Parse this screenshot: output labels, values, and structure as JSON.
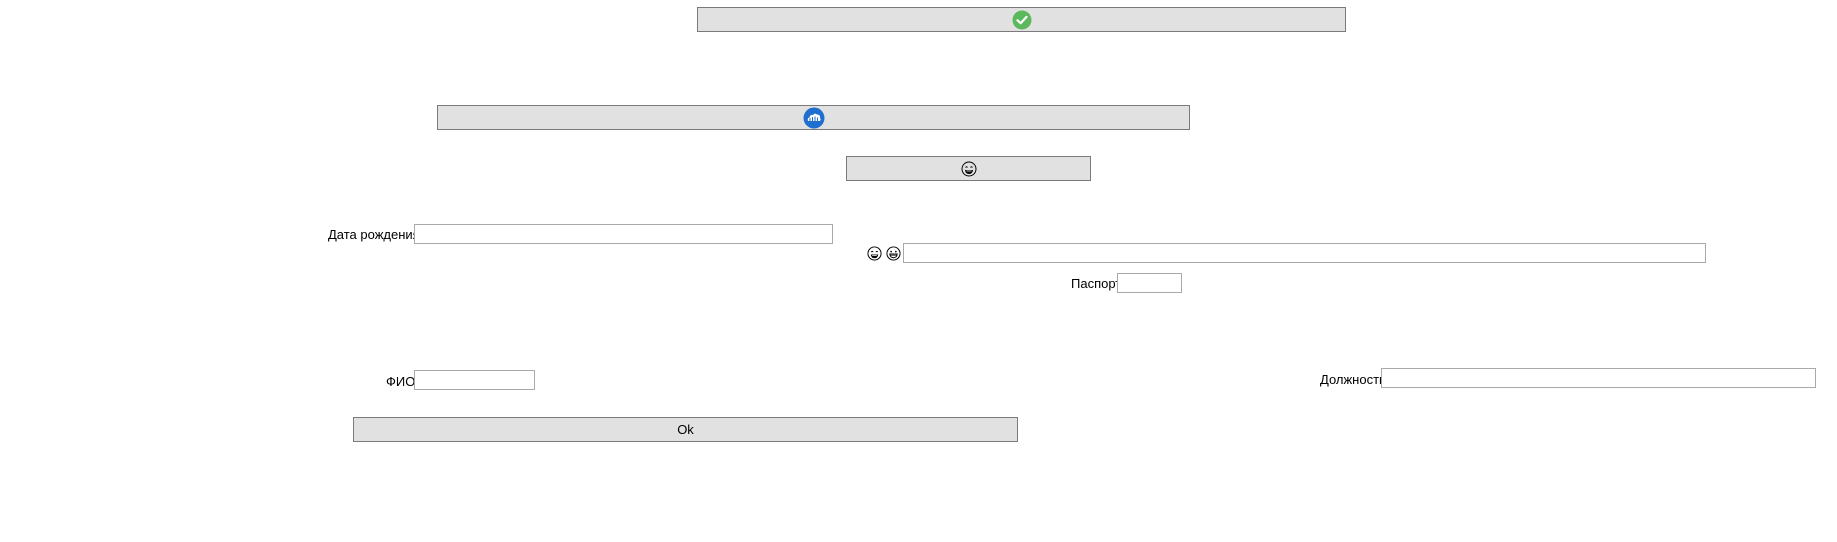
{
  "buttons": {
    "confirm": {
      "icon": "green-check-icon",
      "color": "#5cb85c"
    },
    "cloud": {
      "icon": "blue-cloud-icon",
      "color": "#1e6fd0"
    },
    "emoji": {
      "icon": "laughing-emoji-icon"
    },
    "ok": {
      "label": "Ok"
    }
  },
  "form": {
    "birth_date": {
      "label": "Дата рождения",
      "value": ""
    },
    "emoji_field": {
      "icons": [
        "laughing-emoji-icon",
        "grinning-emoji-icon"
      ],
      "value": ""
    },
    "passport": {
      "label": "Паспорт",
      "value": ""
    },
    "full_name": {
      "label": "ФИО",
      "value": ""
    },
    "position": {
      "label": "Должность",
      "value": ""
    }
  }
}
